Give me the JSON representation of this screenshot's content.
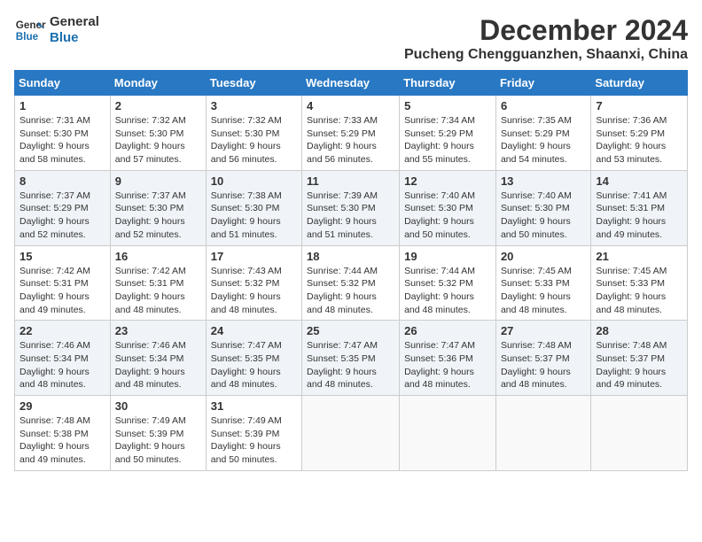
{
  "logo": {
    "line1": "General",
    "line2": "Blue"
  },
  "title": "December 2024",
  "location": "Pucheng Chengguanzhen, Shaanxi, China",
  "days_of_week": [
    "Sunday",
    "Monday",
    "Tuesday",
    "Wednesday",
    "Thursday",
    "Friday",
    "Saturday"
  ],
  "weeks": [
    [
      {
        "day": "1",
        "sunrise": "7:31 AM",
        "sunset": "5:30 PM",
        "daylight": "9 hours and 58 minutes."
      },
      {
        "day": "2",
        "sunrise": "7:32 AM",
        "sunset": "5:30 PM",
        "daylight": "9 hours and 57 minutes."
      },
      {
        "day": "3",
        "sunrise": "7:32 AM",
        "sunset": "5:30 PM",
        "daylight": "9 hours and 56 minutes."
      },
      {
        "day": "4",
        "sunrise": "7:33 AM",
        "sunset": "5:29 PM",
        "daylight": "9 hours and 56 minutes."
      },
      {
        "day": "5",
        "sunrise": "7:34 AM",
        "sunset": "5:29 PM",
        "daylight": "9 hours and 55 minutes."
      },
      {
        "day": "6",
        "sunrise": "7:35 AM",
        "sunset": "5:29 PM",
        "daylight": "9 hours and 54 minutes."
      },
      {
        "day": "7",
        "sunrise": "7:36 AM",
        "sunset": "5:29 PM",
        "daylight": "9 hours and 53 minutes."
      }
    ],
    [
      {
        "day": "8",
        "sunrise": "7:37 AM",
        "sunset": "5:29 PM",
        "daylight": "9 hours and 52 minutes."
      },
      {
        "day": "9",
        "sunrise": "7:37 AM",
        "sunset": "5:30 PM",
        "daylight": "9 hours and 52 minutes."
      },
      {
        "day": "10",
        "sunrise": "7:38 AM",
        "sunset": "5:30 PM",
        "daylight": "9 hours and 51 minutes."
      },
      {
        "day": "11",
        "sunrise": "7:39 AM",
        "sunset": "5:30 PM",
        "daylight": "9 hours and 51 minutes."
      },
      {
        "day": "12",
        "sunrise": "7:40 AM",
        "sunset": "5:30 PM",
        "daylight": "9 hours and 50 minutes."
      },
      {
        "day": "13",
        "sunrise": "7:40 AM",
        "sunset": "5:30 PM",
        "daylight": "9 hours and 50 minutes."
      },
      {
        "day": "14",
        "sunrise": "7:41 AM",
        "sunset": "5:31 PM",
        "daylight": "9 hours and 49 minutes."
      }
    ],
    [
      {
        "day": "15",
        "sunrise": "7:42 AM",
        "sunset": "5:31 PM",
        "daylight": "9 hours and 49 minutes."
      },
      {
        "day": "16",
        "sunrise": "7:42 AM",
        "sunset": "5:31 PM",
        "daylight": "9 hours and 48 minutes."
      },
      {
        "day": "17",
        "sunrise": "7:43 AM",
        "sunset": "5:32 PM",
        "daylight": "9 hours and 48 minutes."
      },
      {
        "day": "18",
        "sunrise": "7:44 AM",
        "sunset": "5:32 PM",
        "daylight": "9 hours and 48 minutes."
      },
      {
        "day": "19",
        "sunrise": "7:44 AM",
        "sunset": "5:32 PM",
        "daylight": "9 hours and 48 minutes."
      },
      {
        "day": "20",
        "sunrise": "7:45 AM",
        "sunset": "5:33 PM",
        "daylight": "9 hours and 48 minutes."
      },
      {
        "day": "21",
        "sunrise": "7:45 AM",
        "sunset": "5:33 PM",
        "daylight": "9 hours and 48 minutes."
      }
    ],
    [
      {
        "day": "22",
        "sunrise": "7:46 AM",
        "sunset": "5:34 PM",
        "daylight": "9 hours and 48 minutes."
      },
      {
        "day": "23",
        "sunrise": "7:46 AM",
        "sunset": "5:34 PM",
        "daylight": "9 hours and 48 minutes."
      },
      {
        "day": "24",
        "sunrise": "7:47 AM",
        "sunset": "5:35 PM",
        "daylight": "9 hours and 48 minutes."
      },
      {
        "day": "25",
        "sunrise": "7:47 AM",
        "sunset": "5:35 PM",
        "daylight": "9 hours and 48 minutes."
      },
      {
        "day": "26",
        "sunrise": "7:47 AM",
        "sunset": "5:36 PM",
        "daylight": "9 hours and 48 minutes."
      },
      {
        "day": "27",
        "sunrise": "7:48 AM",
        "sunset": "5:37 PM",
        "daylight": "9 hours and 48 minutes."
      },
      {
        "day": "28",
        "sunrise": "7:48 AM",
        "sunset": "5:37 PM",
        "daylight": "9 hours and 49 minutes."
      }
    ],
    [
      {
        "day": "29",
        "sunrise": "7:48 AM",
        "sunset": "5:38 PM",
        "daylight": "9 hours and 49 minutes."
      },
      {
        "day": "30",
        "sunrise": "7:49 AM",
        "sunset": "5:39 PM",
        "daylight": "9 hours and 50 minutes."
      },
      {
        "day": "31",
        "sunrise": "7:49 AM",
        "sunset": "5:39 PM",
        "daylight": "9 hours and 50 minutes."
      },
      null,
      null,
      null,
      null
    ]
  ]
}
